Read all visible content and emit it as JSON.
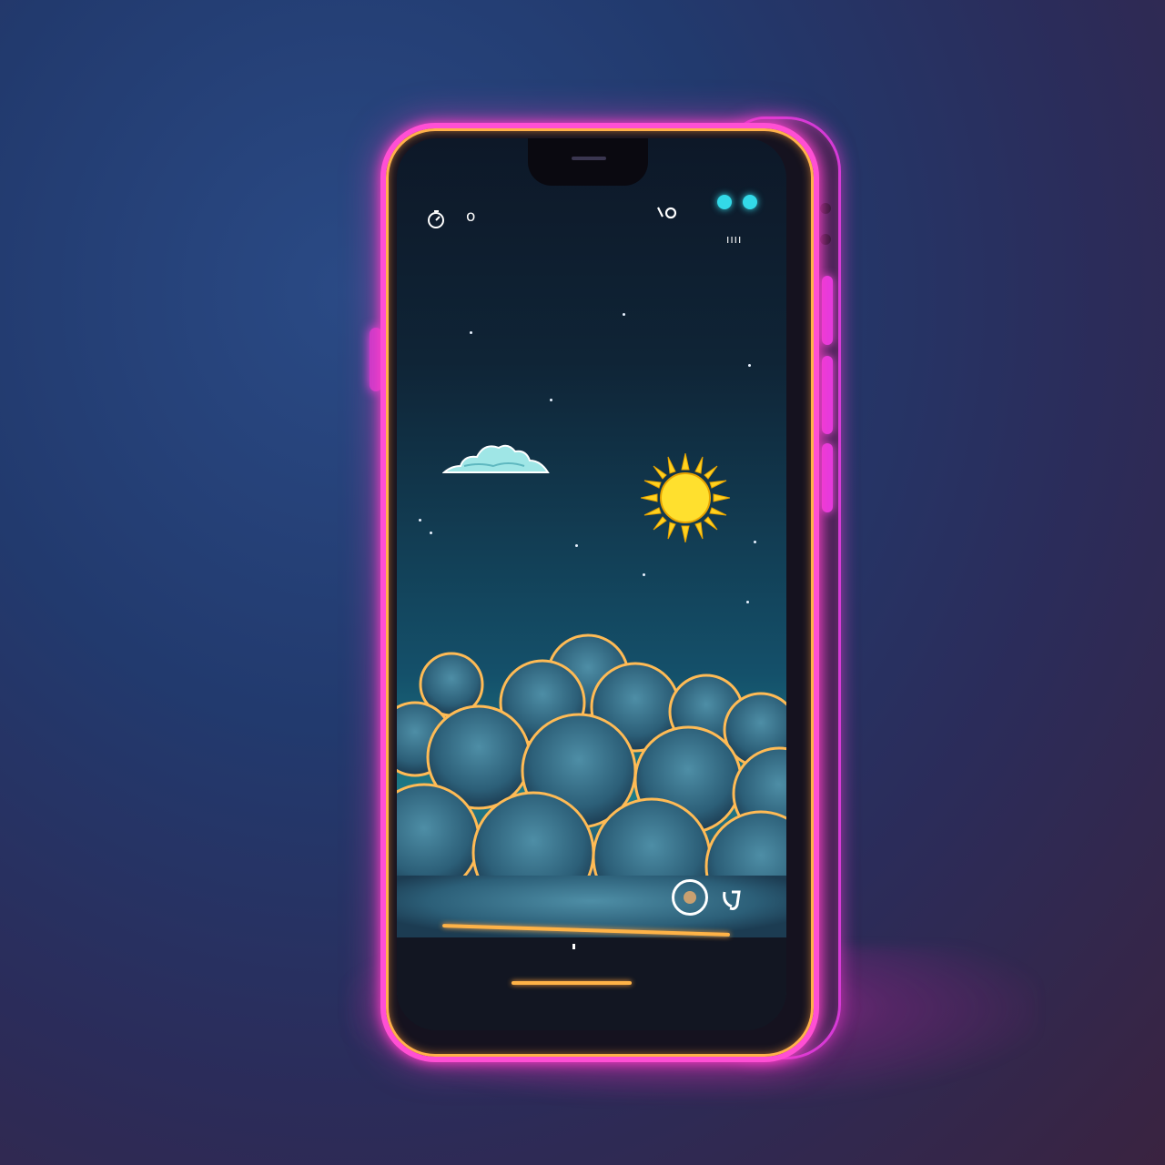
{
  "status_bar": {
    "left_icon": "timer-icon",
    "left_text": "o",
    "right_icon": "link-icon",
    "indicator_dots": 2,
    "signal_text": "ıııı"
  },
  "wallpaper": {
    "scene": "sky",
    "sun_icon": "sun-icon",
    "cloud_icon": "cloud-icon"
  },
  "media_controls": {
    "record_icon": "record-icon",
    "share_icon": "share-icon",
    "progress": 0.5
  },
  "colors": {
    "frame_neon": "#ff4fd4",
    "frame_inner": "#ffb14a",
    "accent_teal": "#33d9e8",
    "sun": "#ffd21f",
    "progress": "#ffb347"
  }
}
